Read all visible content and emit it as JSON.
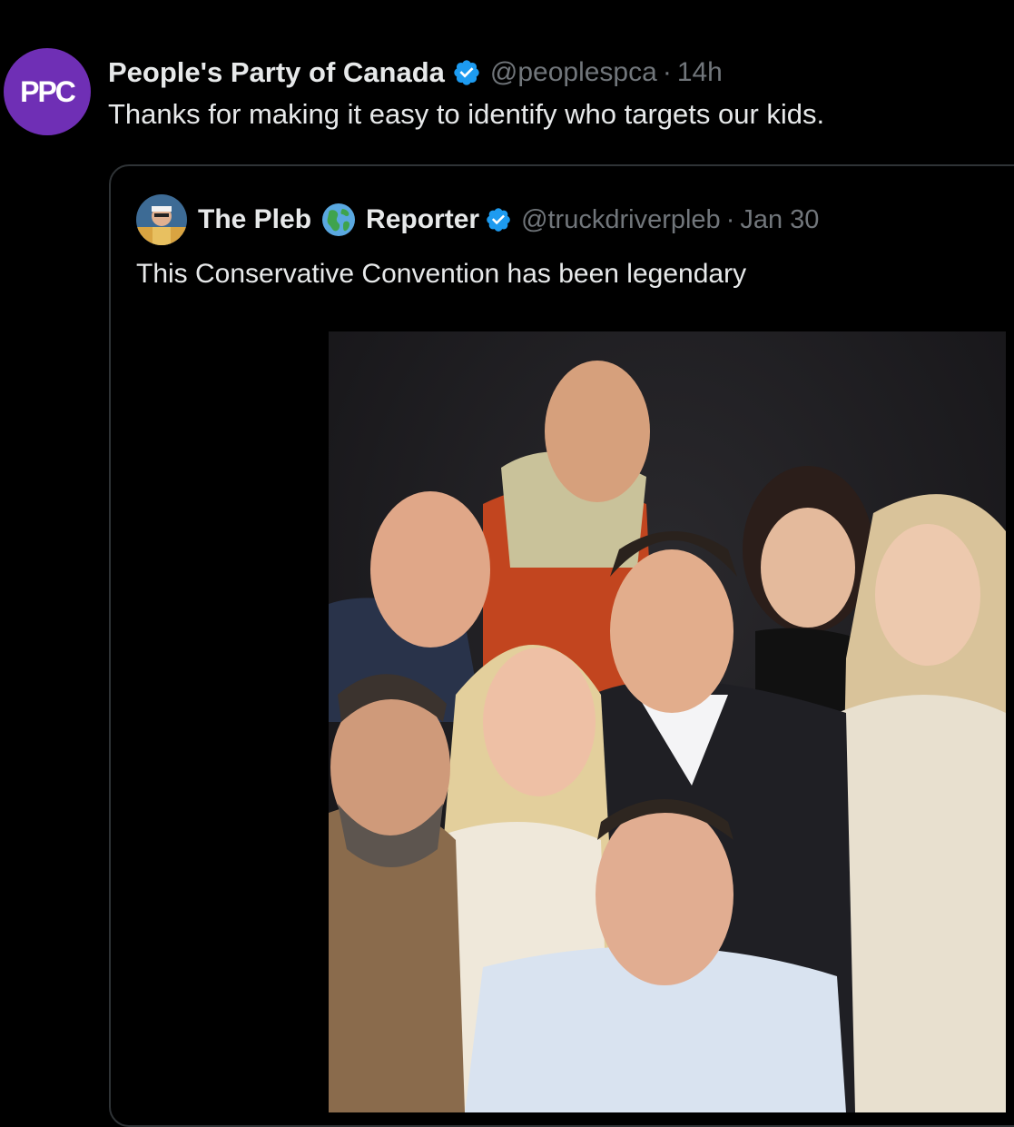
{
  "tweet": {
    "avatar_text": "PPC",
    "display_name": "People's Party of Canada",
    "handle": "@peoplespca",
    "separator": "·",
    "time": "14h",
    "text": "Thanks for making it easy to identify who targets our kids."
  },
  "quote": {
    "name_part1": "The Pleb",
    "name_part2": "Reporter",
    "handle": "@truckdriverpleb",
    "separator": "·",
    "date": "Jan 30",
    "text": "This Conservative Convention has been legendary"
  },
  "icons": {
    "verified": "verified-badge-icon",
    "globe": "globe-emoji-icon"
  },
  "colors": {
    "background": "#000000",
    "text": "#e7e9ea",
    "secondary": "#71767b",
    "verified": "#1d9bf0",
    "ppc_purple": "#6f2fb5",
    "border": "#2f3336"
  }
}
